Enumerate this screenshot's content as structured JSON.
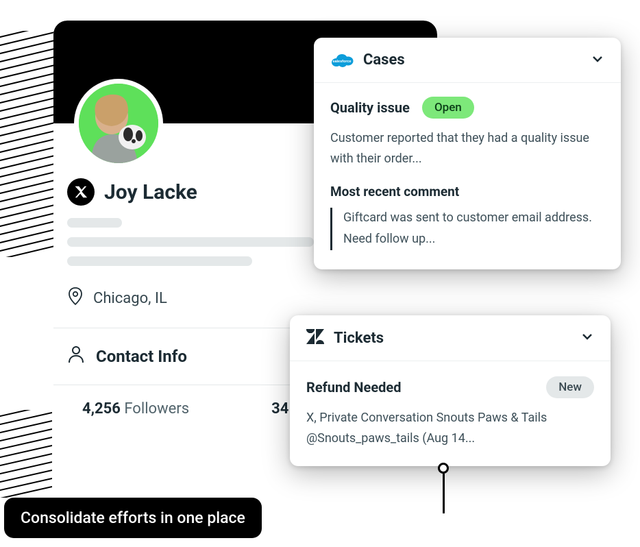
{
  "profile": {
    "name": "Joy Lacke",
    "location": "Chicago, IL",
    "contact_info_label": "Contact Info",
    "followers_count": "4,256",
    "followers_label": "Followers",
    "other_stat_partial": "34"
  },
  "cases_panel": {
    "title": "Cases",
    "integration": "salesforce",
    "case": {
      "title": "Quality issue",
      "status": "Open",
      "description": "Customer reported that they had a quality issue with their order...",
      "recent_comment_label": "Most recent comment",
      "recent_comment": "Giftcard was sent to customer email address. Need follow up..."
    }
  },
  "tickets_panel": {
    "title": "Tickets",
    "integration": "zendesk",
    "ticket": {
      "title": "Refund Needed",
      "status": "New",
      "description": "X, Private Conversation Snouts Paws & Tails @Snouts_paws_tails (Aug 14..."
    }
  },
  "caption": "Consolidate efforts in one place"
}
